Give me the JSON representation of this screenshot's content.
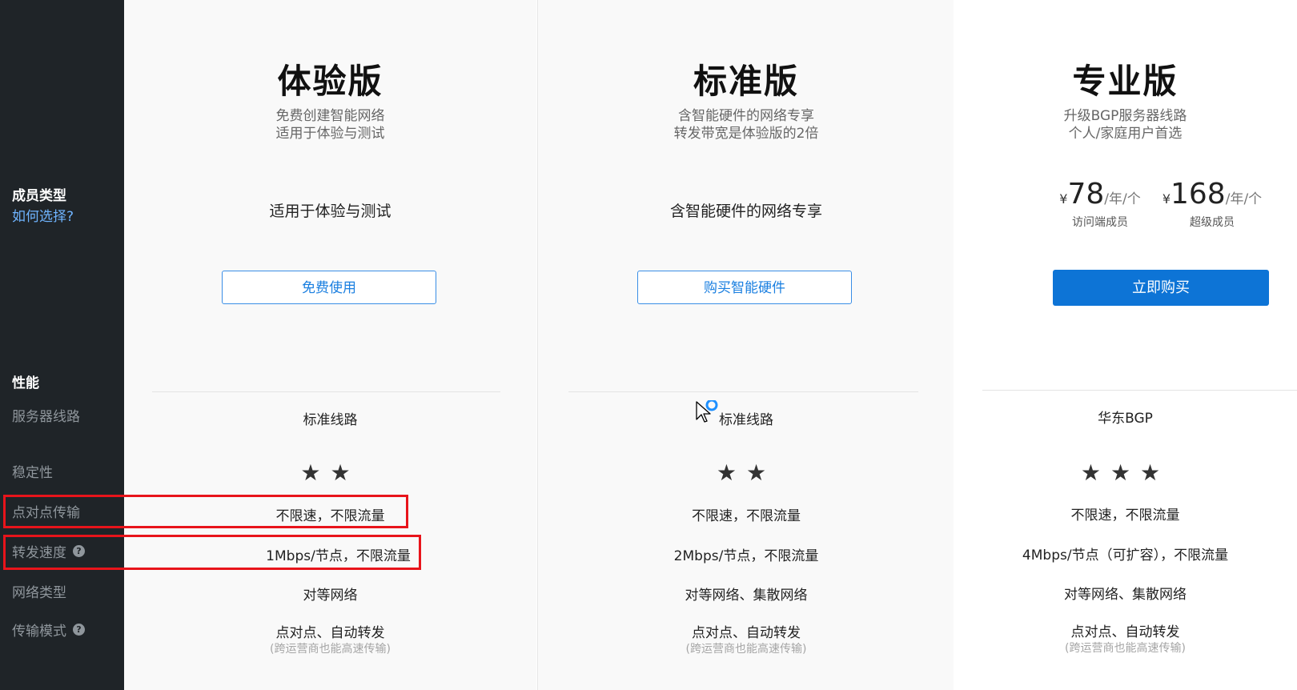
{
  "sidebar": {
    "member_type": "成员类型",
    "how_to_choose": "如何选择?",
    "performance": "性能",
    "server_line": "服务器线路",
    "stability": "稳定性",
    "p2p_transfer": "点对点传输",
    "relay_speed": "转发速度",
    "network_type": "网络类型",
    "transfer_mode": "传输模式",
    "help_glyph": "?"
  },
  "plans": [
    {
      "title": "体验版",
      "subtitle1": "免费创建智能网络",
      "subtitle2": "适用于体验与测试",
      "member_text": "适用于体验与测试",
      "button": "免费使用",
      "server_line": "标准线路",
      "stability_stars": 2,
      "stars_text": "★★",
      "p2p": "不限速，不限流量",
      "relay": "1Mbps/节点，不限流量",
      "network_type": "对等网络",
      "transfer_mode": "点对点、自动转发",
      "transfer_note": "(跨运营商也能高速传输)"
    },
    {
      "title": "标准版",
      "subtitle1": "含智能硬件的网络专享",
      "subtitle2": "转发带宽是体验版的2倍",
      "member_text": "含智能硬件的网络专享",
      "button": "购买智能硬件",
      "server_line": "标准线路",
      "stability_stars": 2,
      "stars_text": "★★",
      "p2p": "不限速，不限流量",
      "relay": "2Mbps/节点，不限流量",
      "network_type": "对等网络、集散网络",
      "transfer_mode": "点对点、自动转发",
      "transfer_note": "(跨运营商也能高速传输)"
    },
    {
      "title": "专业版",
      "subtitle1": "升级BGP服务器线路",
      "subtitle2": "个人/家庭用户首选",
      "prices": [
        {
          "currency": "¥",
          "amount": "78",
          "unit": "/年/个",
          "label": "访问端成员"
        },
        {
          "currency": "¥",
          "amount": "168",
          "unit": "/年/个",
          "label": "超级成员"
        }
      ],
      "button": "立即购买",
      "server_line": "华东BGP",
      "stability_stars": 3,
      "stars_text": "★★★",
      "p2p": "不限速，不限流量",
      "relay": "4Mbps/节点（可扩容），不限流量",
      "network_type": "对等网络、集散网络",
      "transfer_mode": "点对点、自动转发",
      "transfer_note": "(跨运营商也能高速传输)"
    }
  ],
  "colors": {
    "sidebar_bg": "#1f2428",
    "accent": "#0d74d6",
    "highlight_box": "#e8141b"
  }
}
